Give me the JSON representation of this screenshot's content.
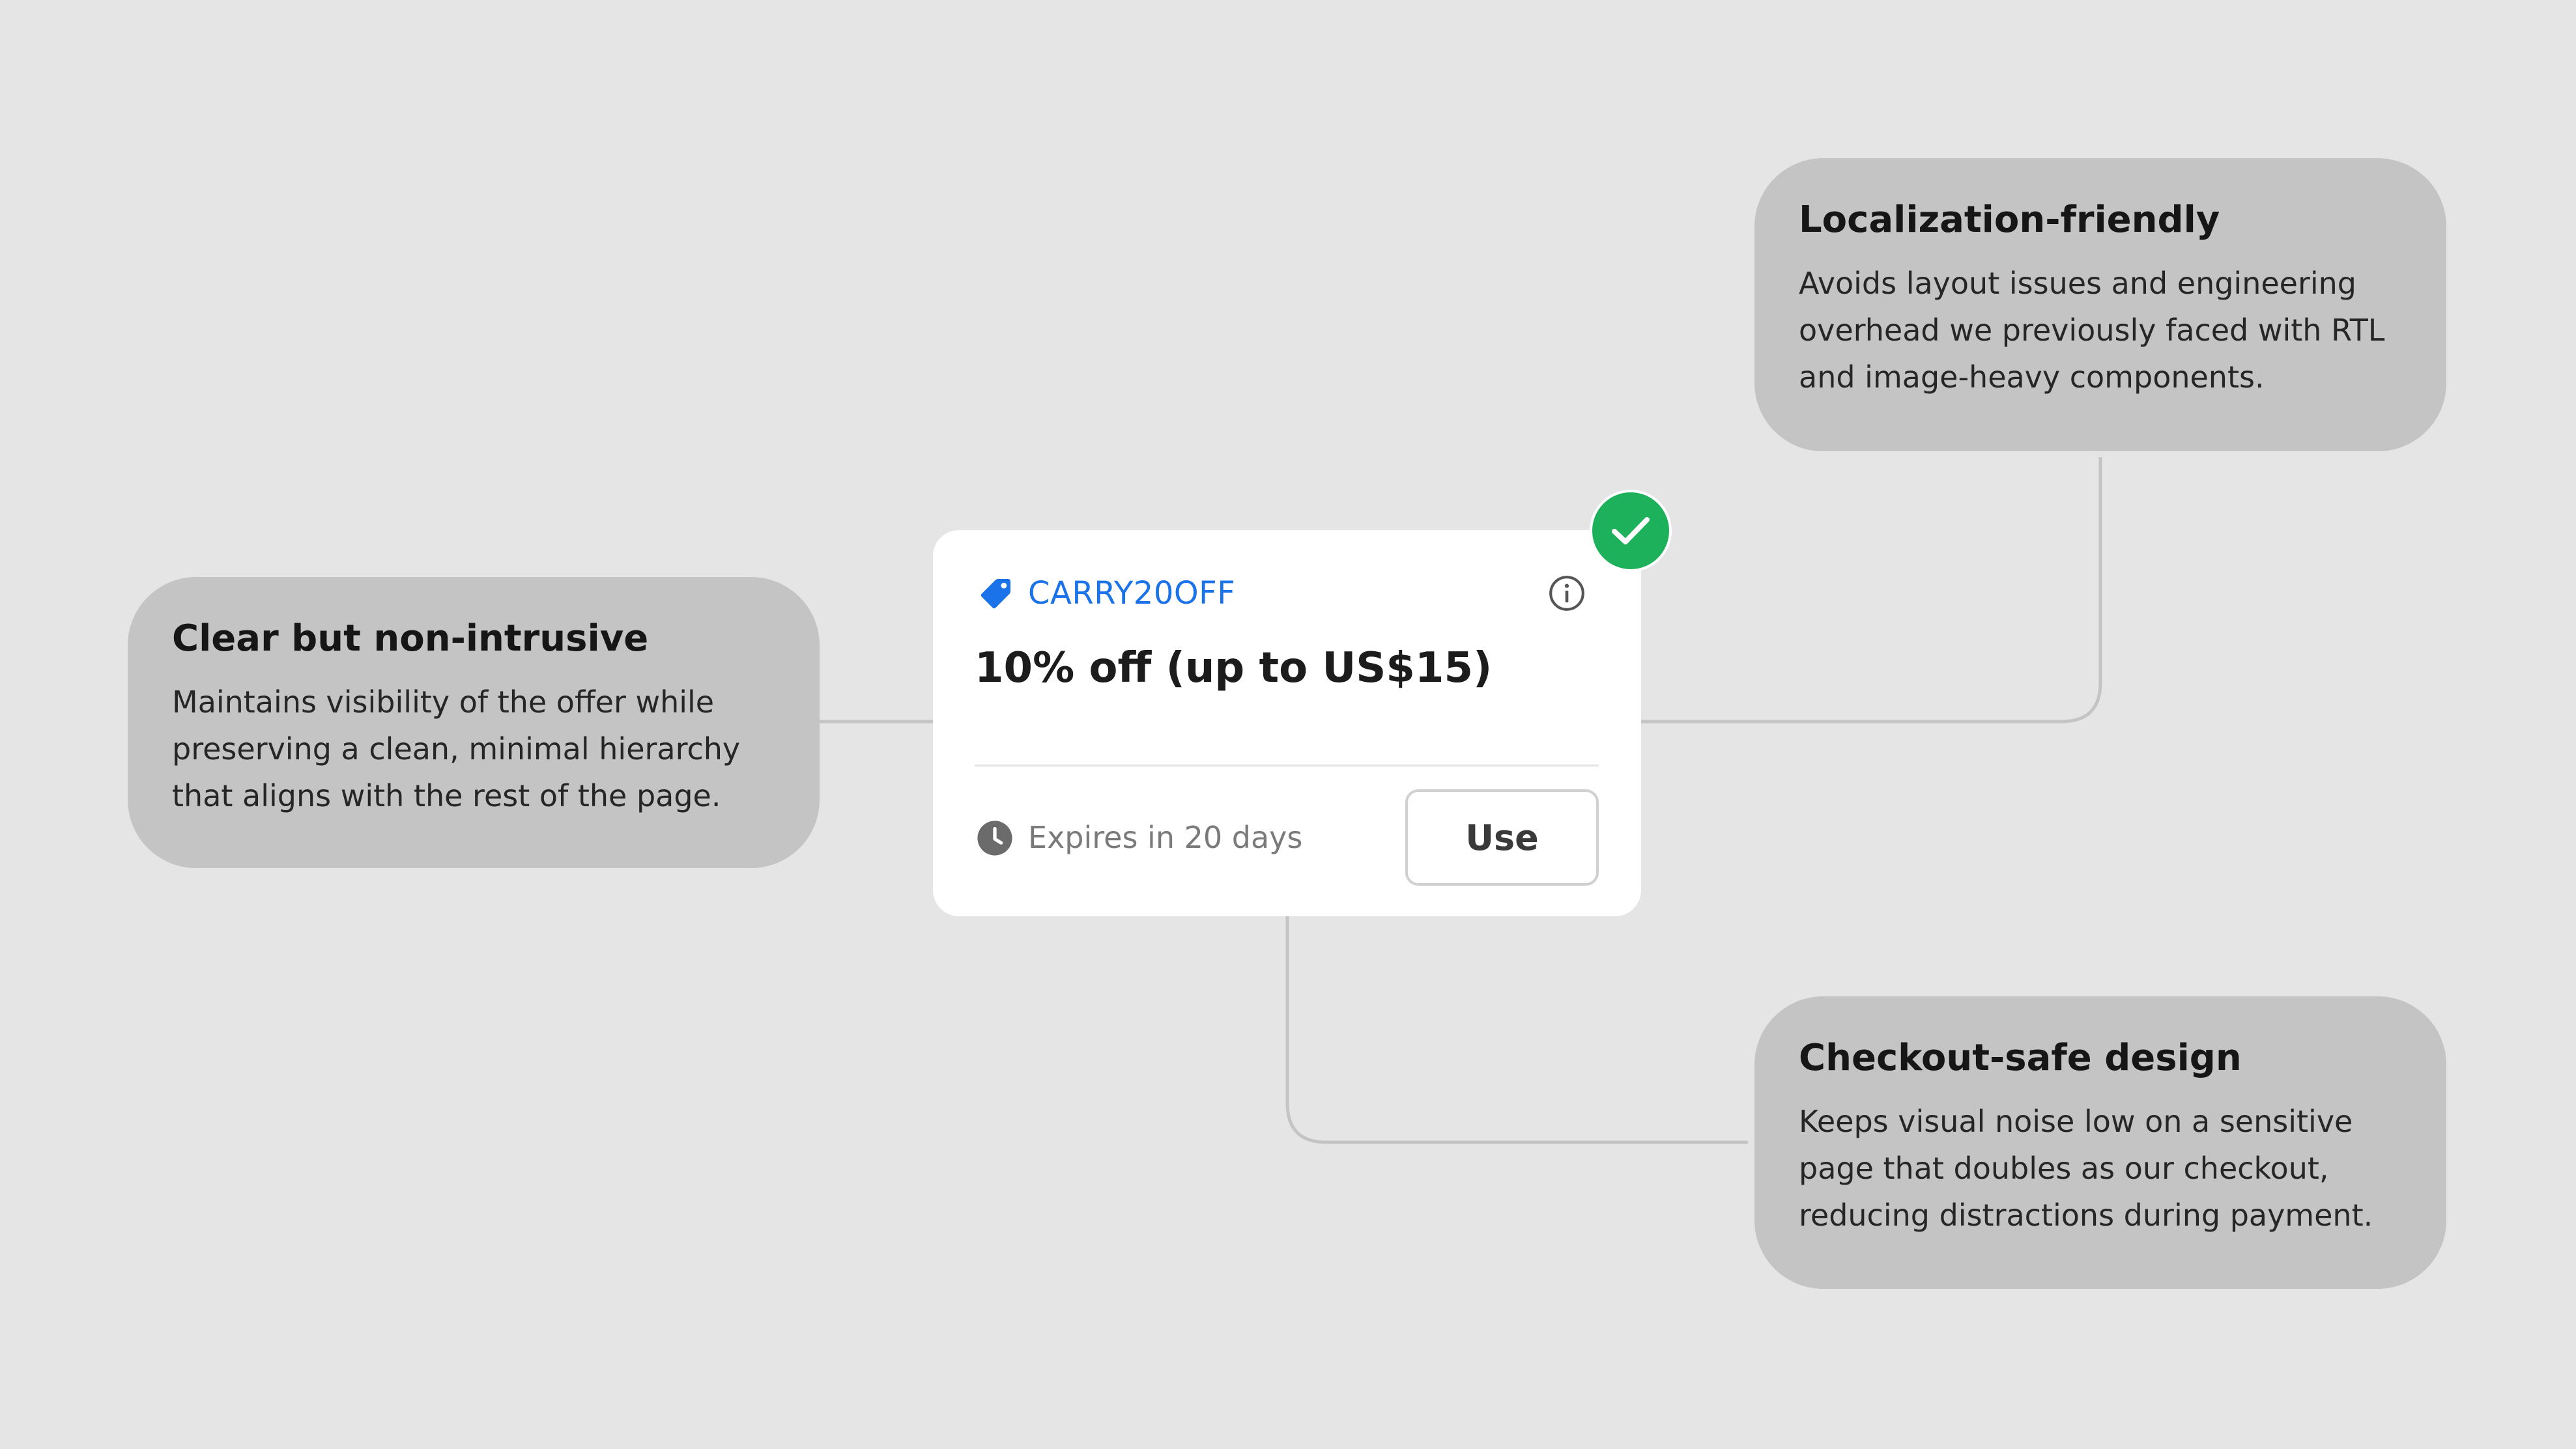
{
  "coupon": {
    "code": "CARRY20OFF",
    "offer": "10% off (up to US$15)",
    "expiry": "Expires in 20 days",
    "use_label": "Use",
    "icons": {
      "tag": "tag-icon",
      "info": "info-icon",
      "clock": "clock-icon",
      "status": "check-icon"
    }
  },
  "callouts": {
    "left": {
      "title": "Clear but non-intrusive",
      "body": "Maintains visibility of the offer while preserving a clean, minimal hierarchy that aligns with the rest of the page."
    },
    "top_right": {
      "title": "Localization-friendly",
      "body": "Avoids layout issues and engineering overhead we previously faced with RTL and image-heavy components."
    },
    "bottom_right": {
      "title": "Checkout-safe design",
      "body": "Keeps visual noise low on a sensitive page that doubles as our checkout, reducing distractions during payment."
    }
  },
  "colors": {
    "background": "#e5e5e5",
    "callout": "#c4c4c4",
    "card": "#ffffff",
    "code_blue": "#1a73e8",
    "success_green": "#1db15b",
    "connector": "#c4c4c4"
  }
}
